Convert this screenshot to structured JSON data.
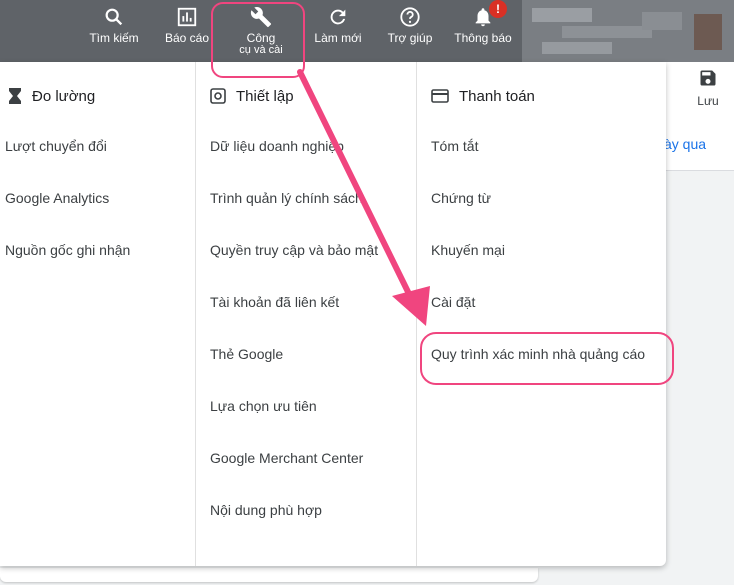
{
  "toolbar": {
    "items": [
      {
        "label": "Tìm kiếm",
        "icon": "search-icon"
      },
      {
        "label": "Báo cáo",
        "icon": "reports-icon"
      },
      {
        "label": "Công",
        "label2": "cụ và cài",
        "icon": "wrench-icon"
      },
      {
        "label": "Làm mới",
        "icon": "refresh-icon"
      },
      {
        "label": "Trợ giúp",
        "icon": "help-icon"
      },
      {
        "label": "Thông báo",
        "icon": "bell-icon",
        "badge": "!"
      }
    ]
  },
  "page": {
    "save_label": "Lưu",
    "link_fragment": "ày qua"
  },
  "menu": {
    "measurement": {
      "title": "Đo lường",
      "icon": "hourglass-icon",
      "items": [
        "Lượt chuyển đổi",
        "Google Analytics",
        "Nguồn gốc ghi nhận"
      ]
    },
    "setup": {
      "title": "Thiết lập",
      "icon": "settings-icon",
      "items": [
        "Dữ liệu doanh nghiệp",
        "Trình quản lý chính sách",
        "Quyền truy cập và bảo mật",
        "Tài khoản đã liên kết",
        "Thẻ Google",
        "Lựa chọn ưu tiên",
        "Google Merchant Center",
        "Nội dung phù hợp"
      ]
    },
    "billing": {
      "title": "Thanh toán",
      "icon": "credit-card-icon",
      "items": [
        "Tóm tắt",
        "Chứng từ",
        "Khuyến mại",
        "Cài đặt",
        "Quy trình xác minh nhà quảng cáo"
      ]
    }
  },
  "colors": {
    "toolbar_bg": "#5f6368",
    "annotation": "#f0457f",
    "link": "#1a73e8"
  }
}
